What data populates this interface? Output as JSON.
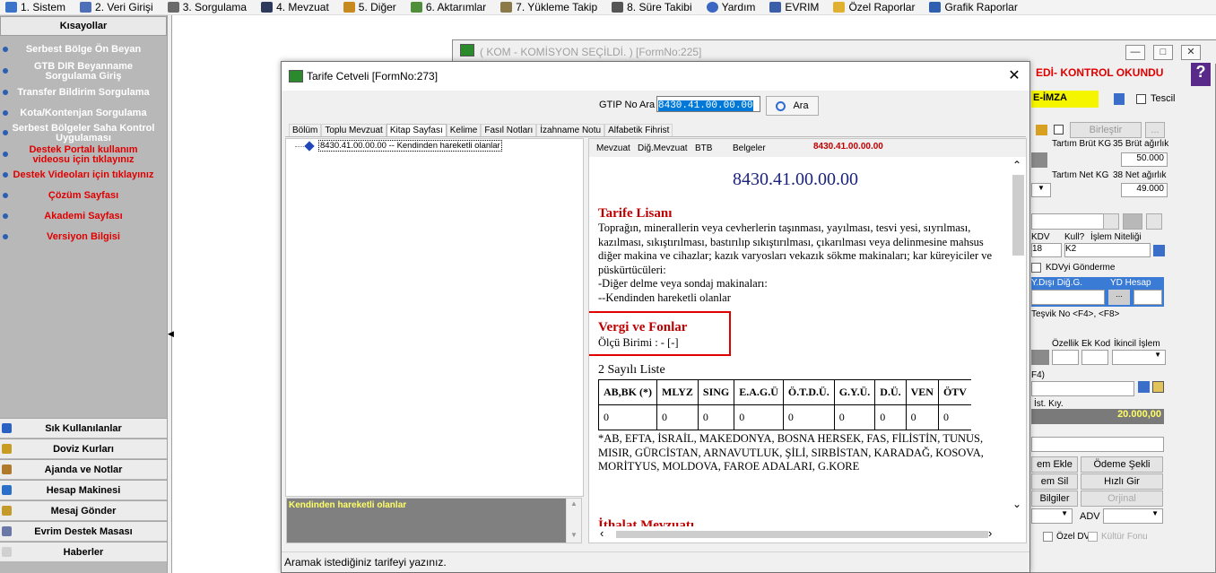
{
  "menubar": {
    "items": [
      {
        "label": "1.  Sistem",
        "color": "#3a73c9"
      },
      {
        "label": "2.  Veri Girişi",
        "color": "#4d6fb8"
      },
      {
        "label": "3.  Sorgulama",
        "color": "#6a6a6a"
      },
      {
        "label": "4.  Mevzuat",
        "color": "#2e3a5c"
      },
      {
        "label": "5.  Diğer",
        "color": "#c78a1e"
      },
      {
        "label": "6.  Aktarımlar",
        "color": "#4f8f3a"
      },
      {
        "label": "7.  Yükleme Takip",
        "color": "#8a7a4a"
      },
      {
        "label": "8. Süre Takibi",
        "color": "#555555"
      },
      {
        "label": "Yardım",
        "color": "#3d66c2"
      },
      {
        "label": "EVRIM",
        "color": "#3a5fa8"
      },
      {
        "label": "Özel Raporlar",
        "color": "#e0b030"
      },
      {
        "label": "Grafik Raporlar",
        "color": "#2f5fae"
      }
    ]
  },
  "sidebar": {
    "header": "Kısayollar",
    "items": [
      {
        "label": "Serbest Bölge Ön Beyan",
        "red": false
      },
      {
        "label": "GTB DIR Beyanname Sorgulama Giriş",
        "red": false
      },
      {
        "label": "Transfer Bildirim Sorgulama",
        "red": false
      },
      {
        "label": "Kota/Kontenjan Sorgulama",
        "red": false
      },
      {
        "label": "Serbest Bölgeler Saha Kontrol Uygulaması",
        "red": false
      },
      {
        "label": "Destek Portalı kullanım videosu için tıklayınız",
        "red": true
      },
      {
        "label": "Destek Videoları için tıklayınız",
        "red": true
      },
      {
        "label": "Çözüm Sayfası",
        "red": true
      },
      {
        "label": "Akademi Sayfası",
        "red": true
      },
      {
        "label": "Versiyon Bilgisi",
        "red": true
      }
    ],
    "bottom": [
      {
        "label": "Sık Kullanılanlar",
        "color": "#2a62c4"
      },
      {
        "label": "Doviz Kurları",
        "color": "#c89b22"
      },
      {
        "label": "Ajanda ve Notlar",
        "color": "#b07a2a"
      },
      {
        "label": "Hesap Makinesi",
        "color": "#2a70c8"
      },
      {
        "label": "Mesaj Gönder",
        "color": "#c49a2a"
      },
      {
        "label": "Evrim Destek Masası",
        "color": "#6a78a8"
      },
      {
        "label": "Haberler",
        "color": "#bbbbbb"
      }
    ]
  },
  "bgform": {
    "title": "( KOM - KOMİSYON SEÇİLDİ. ) [FormNo:225]",
    "edi": "EDİ- KONTROL OKUNDU",
    "eimza": "E-İMZA",
    "tescil": "Tescil",
    "birlestir": "Birleştir",
    "tartim_brut": "Tartım Brüt KG",
    "brut_agirlik": "35 Brüt ağırlık",
    "brut_val": "50.000",
    "tartim_net": "Tartım Net KG",
    "net_agirlik": "38 Net ağırlık",
    "net_val": "49.000",
    "kdv": "KDV",
    "kull": "Kull?",
    "islem_niteligi": "İşlem Niteliği",
    "kdv_val": "18",
    "kull_val": "K2",
    "kdvyi_gonderme": "KDVyi Gönderme",
    "ydisi": "Y.Dışı Diğ.G.",
    "ydhesap": "YD Hesap",
    "tesvik": "Teşvik No <F4>, <F8>",
    "ozellik": "Özellik",
    "ek_kod": "Ek Kod",
    "ikincil": "İkincil İşlem",
    "f4": "F4)",
    "ist_kiy": "İst. Kıy.",
    "amount": "20.000,00",
    "em_ekle": "em Ekle",
    "odeme_sekli": "Ödeme Şekli",
    "em_sil": "em Sil",
    "hizli_gir": "Hızlı Gir",
    "bilgiler": "Bilgiler",
    "orjinal": "Orjinal",
    "adv": "ADV",
    "ozel_dv": "Özel DV",
    "kultur_fonu": "Kültür Fonu"
  },
  "dialog": {
    "title": "Tarife Cetveli [FormNo:273]",
    "gtip_label": "GTIP No Ara",
    "gtip_value": "8430.41.00.00.00",
    "search_button": "Ara",
    "tabs": [
      "Bölüm",
      "Toplu Mevzuat",
      "Kitap Sayfası",
      "Kelime",
      "Fasıl Notları",
      "İzahname Notu",
      "Alfabetik Fihrist"
    ],
    "active_tab": "Kitap Sayfası",
    "tree_item": "8430.41.00.00.00 -- Kendinden hareketli olanlar",
    "note_text": "Kendinden hareketli olanlar",
    "subtabs": [
      "Mevzuat",
      "Diğ.Mevzuat",
      "BTB",
      "Belgeler"
    ],
    "subtab_code": "8430.41.00.00.00",
    "doc": {
      "code": "8430.41.00.00.00",
      "section1_title": "Tarife Lisanı",
      "section1_body": "Toprağın, minerallerin veya cevherlerin taşınması, yayılması, tesvi yesi, sıyrılması, kazılması, sıkıştırılması, bastırılıp sıkıştırılması, çıkarılması veya delinmesine mahsus diğer makina ve cihazlar; kazık varyosları vekazık sökme makinaları; kar küreyiciler ve püskürtücüleri:",
      "section1_line2": "-Diğer delme veya sondaj makinaları:",
      "section1_line3": "--Kendinden hareketli olanlar",
      "section2_title": "Vergi ve Fonlar",
      "olcu": "Ölçü Birimi : - [-]",
      "list_title": "2 Sayılı Liste",
      "table_headers": [
        "AB,BK (*)",
        "MLYZ",
        "SING",
        "E.A.G.Ü",
        "Ö.T.D.Ü.",
        "G.Y.Ü.",
        "D.Ü.",
        "VEN",
        "ÖTV"
      ],
      "table_values": [
        "0",
        "0",
        "0",
        "0",
        "0",
        "0",
        "0",
        "0",
        "0"
      ],
      "footnote": "*AB, EFTA, İSRAİL, MAKEDONYA, BOSNA HERSEK, FAS, FİLİSTİN, TUNUS, MISIR, GÜRCİSTAN, ARNAVUTLUK, ŞİLİ, SIRBİSTAN, KARADAĞ, KOSOVA, MORİTYUS, MOLDOVA, FAROE ADALARI, G.KORE",
      "section3_title": "İthalat Mevzuatı"
    },
    "status": "Aramak istediğiniz tarifeyi yazınız."
  },
  "colors": {
    "accent_red": "#e00000",
    "doc_title_red": "#c00000",
    "doc_code_blue": "#1a237e",
    "ydhesap_blue": "#3a7bd5",
    "amount_bg": "#7a7a7a"
  }
}
